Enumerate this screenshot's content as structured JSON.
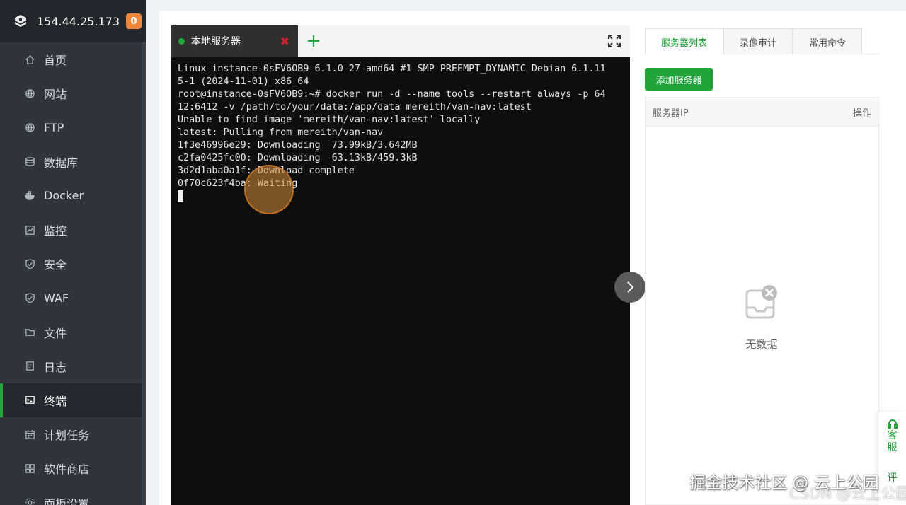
{
  "sidebar": {
    "server_ip": "154.44.25.173",
    "badge_count": "0",
    "items": [
      {
        "label": "首页",
        "icon": "home-icon"
      },
      {
        "label": "网站",
        "icon": "globe-icon"
      },
      {
        "label": "FTP",
        "icon": "globe-icon"
      },
      {
        "label": "数据库",
        "icon": "database-icon"
      },
      {
        "label": "Docker",
        "icon": "docker-icon"
      },
      {
        "label": "监控",
        "icon": "monitor-icon"
      },
      {
        "label": "安全",
        "icon": "shield-icon"
      },
      {
        "label": "WAF",
        "icon": "shield-icon"
      },
      {
        "label": "文件",
        "icon": "folder-icon"
      },
      {
        "label": "日志",
        "icon": "log-icon"
      },
      {
        "label": "终端",
        "icon": "terminal-icon",
        "active": true
      },
      {
        "label": "计划任务",
        "icon": "calendar-icon"
      },
      {
        "label": "软件商店",
        "icon": "apps-icon"
      },
      {
        "label": "面板设置",
        "icon": "gear-icon"
      }
    ]
  },
  "terminal": {
    "tab_label": "本地服务器",
    "tab_close": "✖",
    "add_tab": "+",
    "lines": [
      "Linux instance-0sFV6OB9 6.1.0-27-amd64 #1 SMP PREEMPT_DYNAMIC Debian 6.1.11",
      "5-1 (2024-11-01) x86_64",
      "root@instance-0sFV6OB9:~# docker run -d --name tools --restart always -p 64",
      "12:6412 -v /path/to/your/data:/app/data mereith/van-nav:latest",
      "Unable to find image 'mereith/van-nav:latest' locally",
      "latest: Pulling from mereith/van-nav",
      "1f3e46996e29: Downloading  73.99kB/3.642MB",
      "c2fa0425fc00: Downloading  63.13kB/459.3kB",
      "3d2d1aba0a1f: Download complete",
      "0f70c623f4ba: Waiting"
    ]
  },
  "right_panel": {
    "tabs": [
      {
        "label": "服务器列表",
        "active": true
      },
      {
        "label": "录像审计"
      },
      {
        "label": "常用命令"
      }
    ],
    "add_button": "添加服务器",
    "table": {
      "col_ip": "服务器IP",
      "col_op": "操作"
    },
    "empty_text": "无数据"
  },
  "service_widget": {
    "label1": "客",
    "label2": "服",
    "label3": "评"
  },
  "watermark": {
    "main": "掘金技术社区 @ 云上公园",
    "secondary": "CSDN @云上公园"
  },
  "colors": {
    "accent": "#20a53a",
    "sidebar_bg": "#31353b",
    "terminal_bg": "#0e0e0e",
    "badge": "#f0873b"
  }
}
